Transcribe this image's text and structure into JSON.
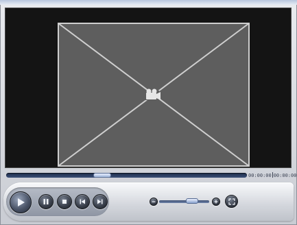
{
  "player": {
    "time": {
      "current": "00:00:00",
      "total": "00:00:00"
    },
    "seek_position_fraction": 0.4,
    "volume_fraction": 0.6,
    "icons": {
      "placeholder": "video-camera-icon",
      "play": "play-icon",
      "pause": "pause-icon",
      "stop": "stop-icon",
      "previous": "skip-previous-icon",
      "next": "skip-next-icon",
      "volume_down": "minus-icon",
      "volume_up": "plus-icon",
      "fullscreen": "expand-icon"
    },
    "colors": {
      "viewport": "#141414",
      "placeholder_fill": "#5e5e5e",
      "placeholder_stroke": "#cfcfcf",
      "seek_track": "#2b3c60",
      "button_dark": "#2a2f38"
    }
  }
}
